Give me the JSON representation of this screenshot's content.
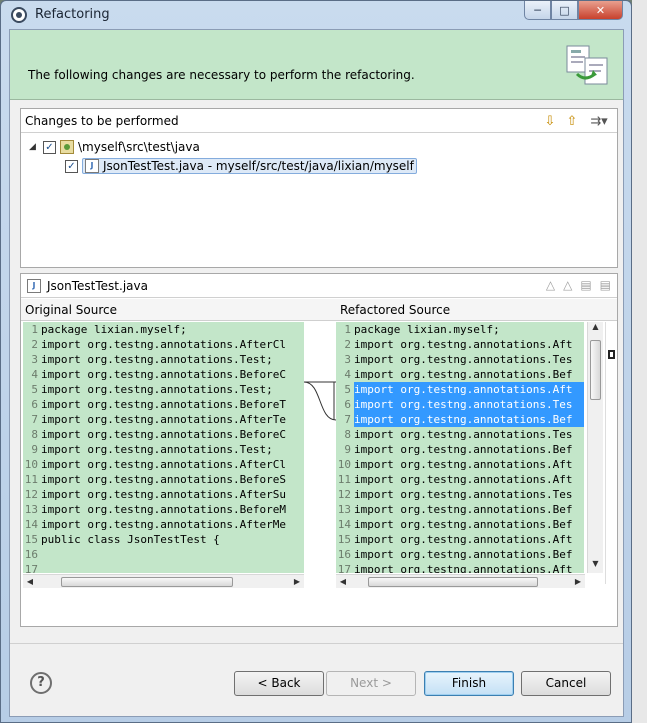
{
  "window": {
    "title": "Refactoring"
  },
  "banner": {
    "message": "The following changes are necessary to perform the refactoring."
  },
  "changes": {
    "heading": "Changes to be performed",
    "tree": [
      {
        "label": "\\myself\\src\\test\\java",
        "checked": true,
        "expanded": true
      },
      {
        "label": "JsonTestTest.java - myself/src/test/java/lixian/myself",
        "checked": true,
        "selected": true
      }
    ]
  },
  "compare": {
    "file_title": "JsonTestTest.java",
    "original_header": "Original Source",
    "refactored_header": "Refactored Source",
    "original_lines": [
      {
        "n": "1",
        "t": "package lixian.myself;"
      },
      {
        "n": "2",
        "t": "import org.testng.annotations.AfterCl"
      },
      {
        "n": "3",
        "t": "import org.testng.annotations.Test;"
      },
      {
        "n": "4",
        "t": "import org.testng.annotations.BeforeC"
      },
      {
        "n": "5",
        "t": "import org.testng.annotations.Test;"
      },
      {
        "n": "6",
        "t": "import org.testng.annotations.BeforeT"
      },
      {
        "n": "7",
        "t": "import org.testng.annotations.AfterTe"
      },
      {
        "n": "8",
        "t": "import org.testng.annotations.BeforeC"
      },
      {
        "n": "9",
        "t": "import org.testng.annotations.Test;"
      },
      {
        "n": "10",
        "t": "import org.testng.annotations.AfterCl"
      },
      {
        "n": "11",
        "t": "import org.testng.annotations.BeforeS"
      },
      {
        "n": "12",
        "t": "import org.testng.annotations.AfterSu"
      },
      {
        "n": "13",
        "t": "import org.testng.annotations.BeforeM"
      },
      {
        "n": "14",
        "t": "import org.testng.annotations.AfterMe"
      },
      {
        "n": "15",
        "t": "public class JsonTestTest {"
      },
      {
        "n": "16",
        "t": ""
      },
      {
        "n": "17",
        "t": ""
      }
    ],
    "refactored_lines": [
      {
        "n": "1",
        "t": "package lixian.myself;"
      },
      {
        "n": "2",
        "t": "import org.testng.annotations.Aft"
      },
      {
        "n": "3",
        "t": "import org.testng.annotations.Tes"
      },
      {
        "n": "4",
        "t": "import org.testng.annotations.Bef"
      },
      {
        "n": "5",
        "t": "import org.testng.annotations.Aft",
        "hl": true
      },
      {
        "n": "6",
        "t": "import org.testng.annotations.Tes",
        "hl": true
      },
      {
        "n": "7",
        "t": "import org.testng.annotations.Bef",
        "hl": true
      },
      {
        "n": "8",
        "t": "import org.testng.annotations.Tes"
      },
      {
        "n": "9",
        "t": "import org.testng.annotations.Bef"
      },
      {
        "n": "10",
        "t": "import org.testng.annotations.Aft"
      },
      {
        "n": "11",
        "t": "import org.testng.annotations.Aft"
      },
      {
        "n": "12",
        "t": "import org.testng.annotations.Tes"
      },
      {
        "n": "13",
        "t": "import org.testng.annotations.Bef"
      },
      {
        "n": "14",
        "t": "import org.testng.annotations.Bef"
      },
      {
        "n": "15",
        "t": "import org.testng.annotations.Aft"
      },
      {
        "n": "16",
        "t": "import org.testng.annotations.Bef"
      },
      {
        "n": "17",
        "t": "import org.testng.annotations.Aft"
      }
    ]
  },
  "buttons": {
    "help": "?",
    "back": "< Back",
    "next": "Next >",
    "finish": "Finish",
    "cancel": "Cancel"
  },
  "icons": {
    "window": "eclipse-icon",
    "banner": "refactoring-wizard-icon",
    "down": "next-change-icon",
    "up": "previous-change-icon",
    "filter": "filter-icon",
    "java": "java-file-icon"
  },
  "colors": {
    "banner_bg": "#c3e6c9",
    "code_bg": "#c3e6c9",
    "highlight": "#3399ff"
  }
}
